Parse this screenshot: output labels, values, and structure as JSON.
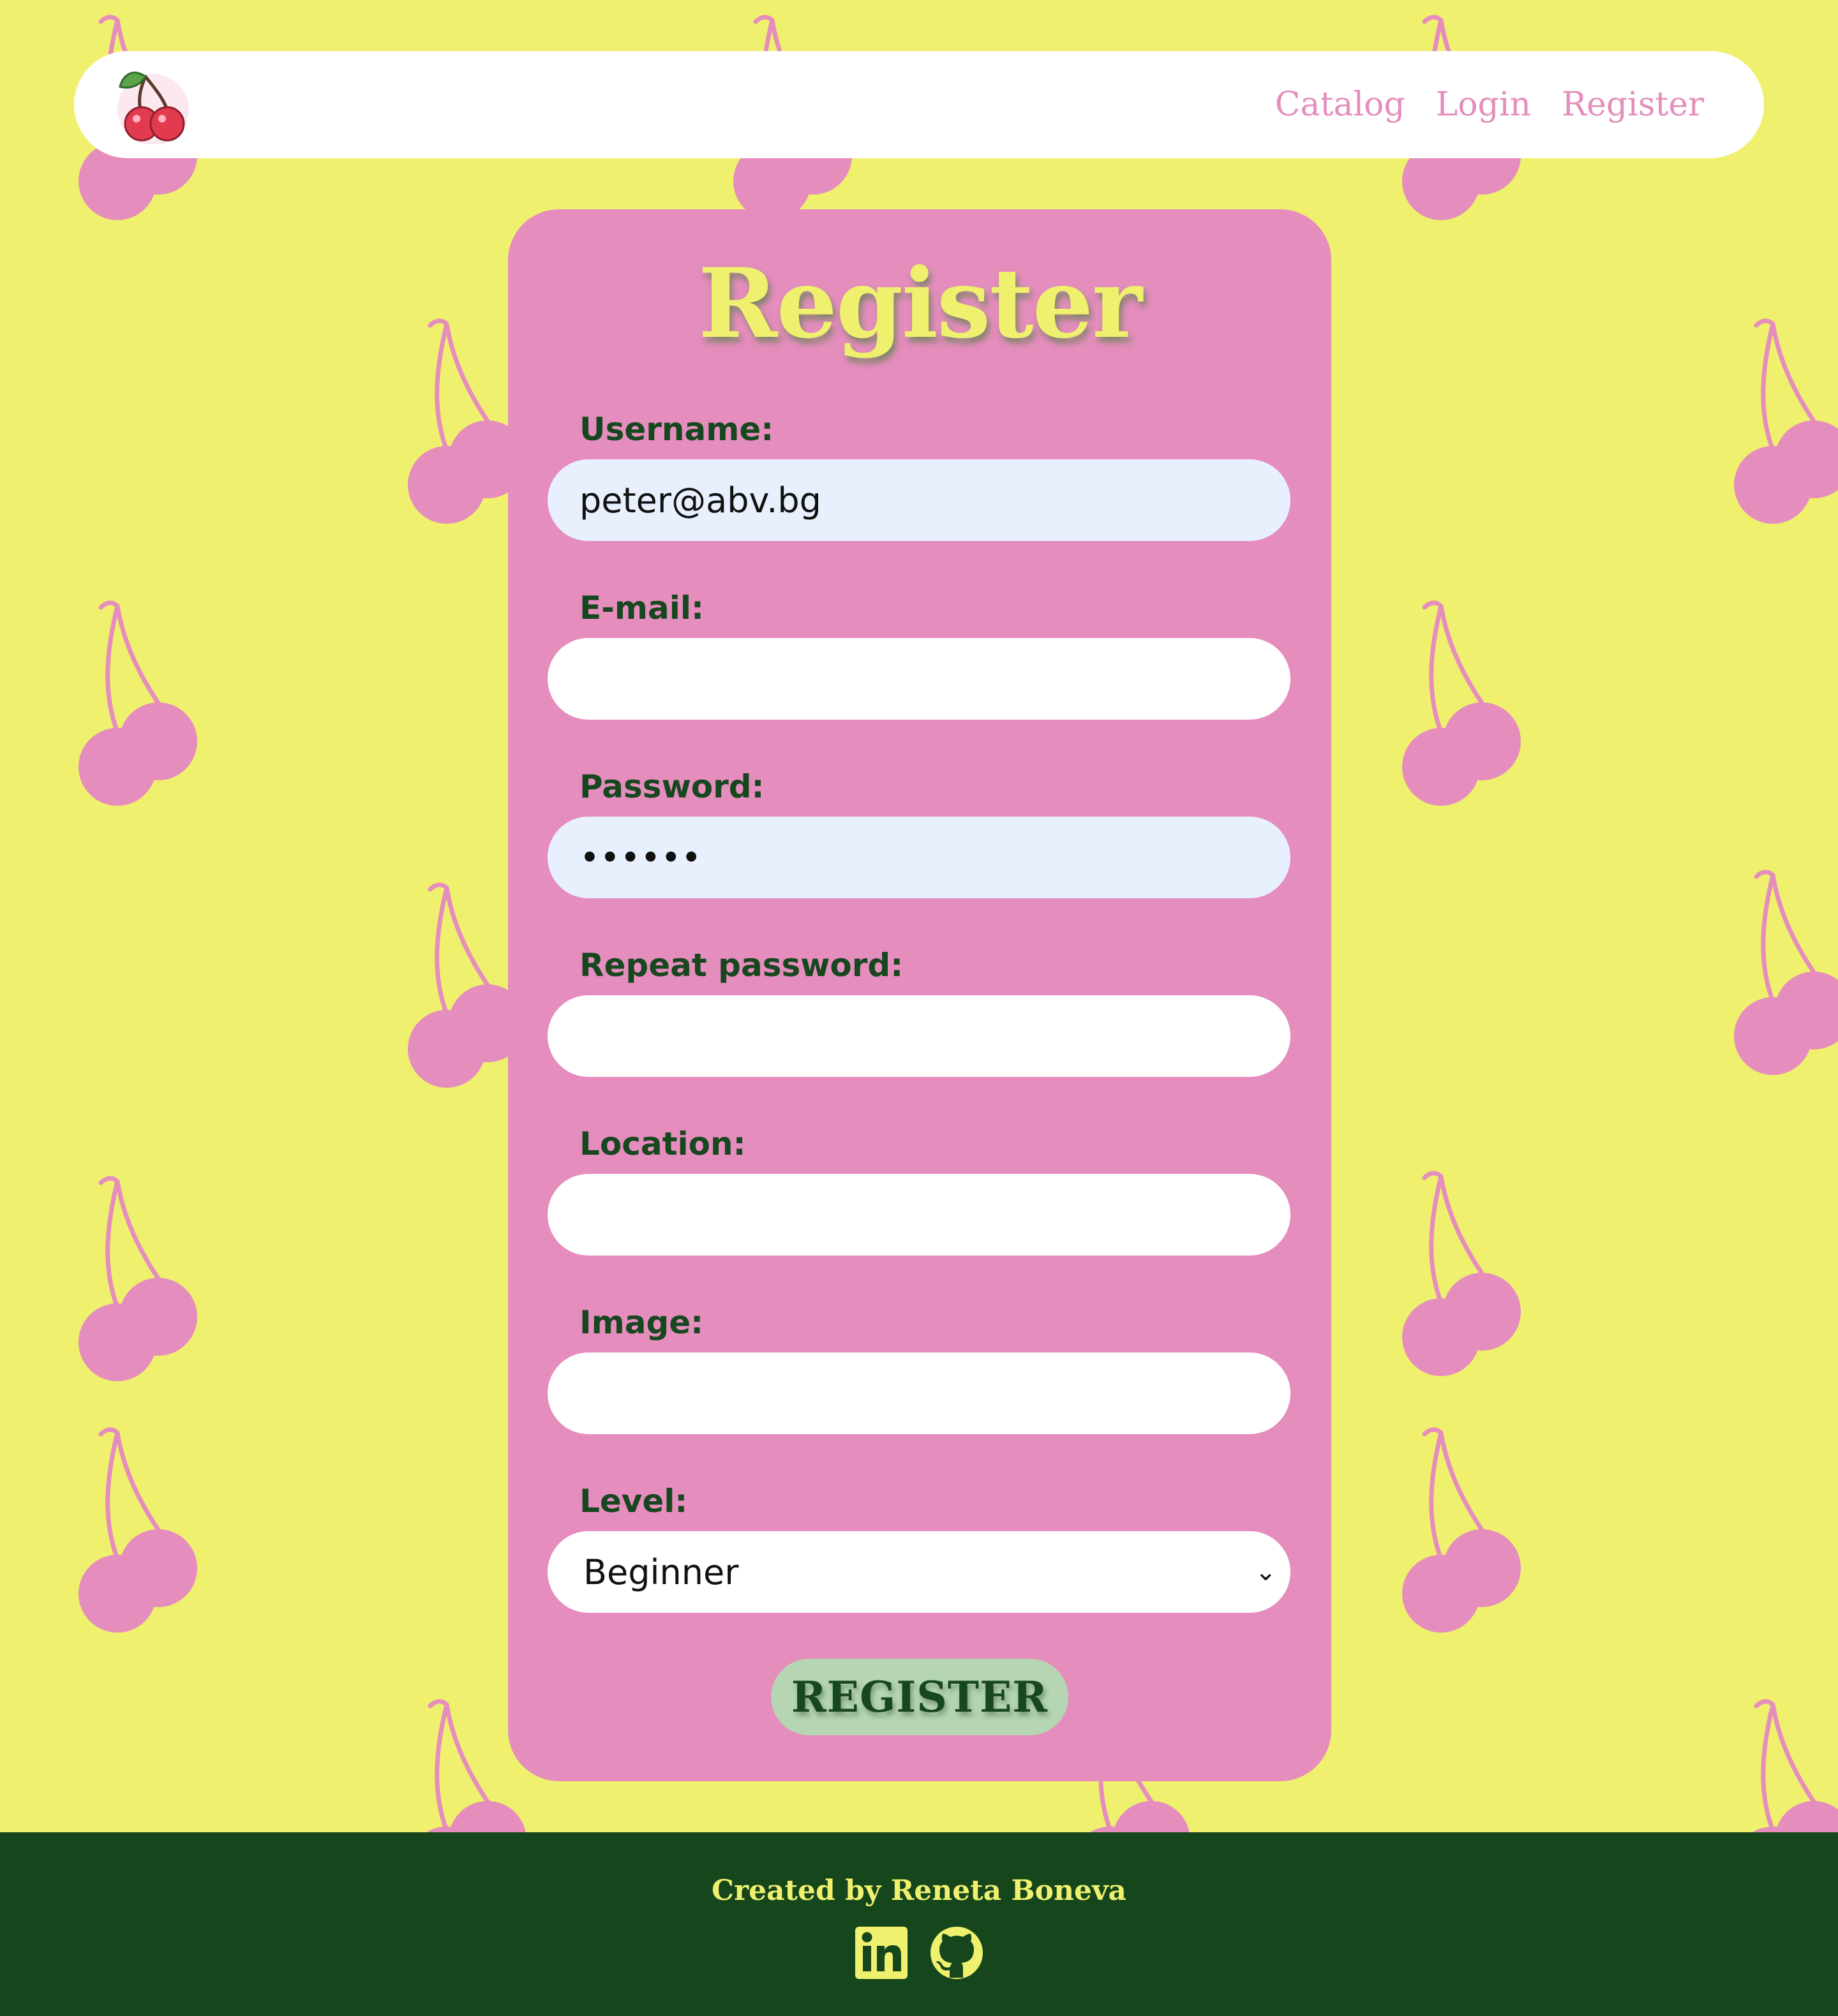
{
  "header": {
    "nav": [
      "Catalog",
      "Login",
      "Register"
    ]
  },
  "form": {
    "title": "Register",
    "fields": [
      {
        "label": "Username:",
        "value": "peter@abv.bg"
      },
      {
        "label": "E-mail:",
        "value": ""
      },
      {
        "label": "Password:",
        "value": "••••••"
      },
      {
        "label": "Repeat password:",
        "value": ""
      },
      {
        "label": "Location:",
        "value": ""
      },
      {
        "label": "Image:",
        "value": ""
      },
      {
        "label": "Level:",
        "value": "Beginner"
      }
    ],
    "submit_label": "REGISTER"
  },
  "footer": {
    "credit": "Created by Reneta Boneva",
    "icons": [
      "linkedin-icon",
      "github-icon"
    ]
  },
  "colors": {
    "background": "#eff06e",
    "accent_pink": "#e58dbd",
    "dark_green": "#16471c",
    "button_green": "#b5d5b3",
    "autofill_blue": "#e8f0fe"
  }
}
